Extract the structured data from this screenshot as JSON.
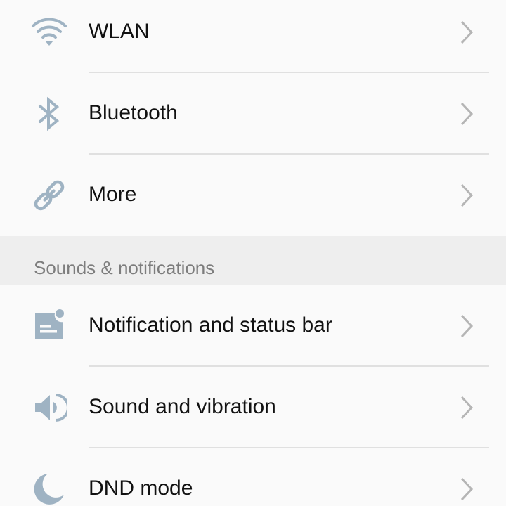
{
  "connectivity": {
    "items": [
      {
        "label": "WLAN",
        "icon": "wifi-icon"
      },
      {
        "label": "Bluetooth",
        "icon": "bluetooth-icon"
      },
      {
        "label": "More",
        "icon": "link-icon"
      }
    ]
  },
  "sounds_section": {
    "title": "Sounds & notifications",
    "items": [
      {
        "label": "Notification and status bar",
        "icon": "notification-icon"
      },
      {
        "label": "Sound and vibration",
        "icon": "speaker-icon"
      },
      {
        "label": "DND mode",
        "icon": "moon-icon"
      }
    ]
  },
  "colors": {
    "icon": "#9fb3c3",
    "chevron": "#b5b5b5",
    "divider": "#e0e0e0",
    "section_background": "#eeeeee",
    "background": "#fafafa"
  }
}
